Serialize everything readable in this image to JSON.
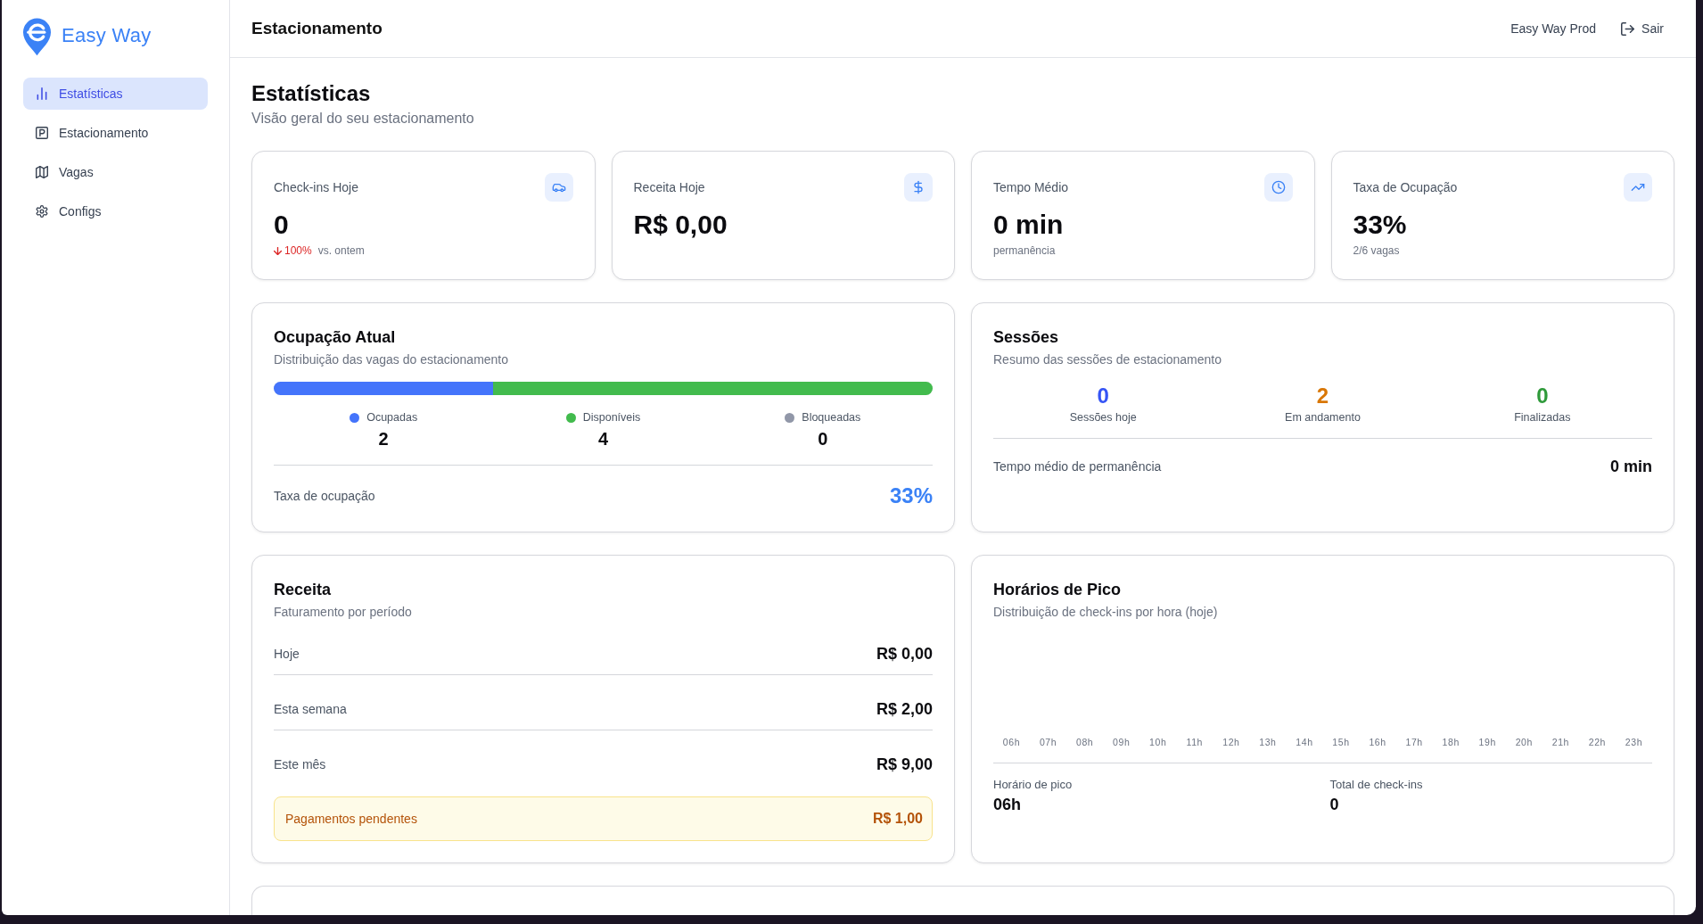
{
  "sidebar": {
    "brand": "Easy Way",
    "items": [
      {
        "label": "Estatísticas",
        "selected": true
      },
      {
        "label": "Estacionamento",
        "selected": false
      },
      {
        "label": "Vagas",
        "selected": false
      },
      {
        "label": "Configs",
        "selected": false
      }
    ]
  },
  "header": {
    "title": "Estacionamento",
    "account": "Easy Way Prod",
    "logout": "Sair"
  },
  "page": {
    "title": "Estatísticas",
    "subtitle": "Visão geral do seu estacionamento"
  },
  "stat_cards": [
    {
      "label": "Check-ins Hoje",
      "value": "0",
      "trend": {
        "decrease": true,
        "value": "100%",
        "note": "vs. ontem"
      }
    },
    {
      "label": "Receita Hoje",
      "value": "R$ 0,00"
    },
    {
      "label": "Tempo Médio",
      "value": "0 min",
      "note": "permanência"
    },
    {
      "label": "Taxa de Ocupação",
      "value": "33%",
      "note": "2/6 vagas"
    }
  ],
  "occupancy": {
    "title": "Ocupação Atual",
    "subtitle": "Distribuição das vagas do estacionamento",
    "legend": [
      {
        "label": "Ocupadas",
        "value": "2",
        "color": "#4474fb",
        "level": 0.333
      },
      {
        "label": "Disponíveis",
        "value": "4",
        "color": "#42bb4d",
        "level": 0.667
      },
      {
        "label": "Bloqueadas",
        "value": "0",
        "color": "#9197a8"
      }
    ],
    "rate_label": "Taxa de ocupação",
    "rate_value": "33%"
  },
  "sessions": {
    "title": "Sessões",
    "subtitle": "Resumo das sessões de estacionamento",
    "stats": [
      {
        "value": "0",
        "label": "Sessões hoje",
        "color": "#3554f5"
      },
      {
        "value": "2",
        "label": "Em andamento",
        "color": "#d97706"
      },
      {
        "value": "0",
        "label": "Finalizadas",
        "color": "#2f9a3a"
      }
    ],
    "average_label": "Tempo médio de permanência",
    "average_value": "0 min"
  },
  "revenue": {
    "title": "Receita",
    "subtitle": "Faturamento por período",
    "rows": [
      {
        "label": "Hoje",
        "value": "R$ 0,00"
      },
      {
        "label": "Esta semana",
        "value": "R$ 2,00"
      },
      {
        "label": "Este mês",
        "value": "R$ 9,00"
      }
    ],
    "pending": {
      "label": "Pagamentos pendentes",
      "value": "R$ 1,00"
    }
  },
  "peak_hours": {
    "title": "Horários de Pico",
    "subtitle": "Distribuição de check-ins por hora (hoje)",
    "hours": [
      "06h",
      "07h",
      "08h",
      "09h",
      "10h",
      "11h",
      "12h",
      "13h",
      "14h",
      "15h",
      "16h",
      "17h",
      "18h",
      "19h",
      "20h",
      "21h",
      "22h",
      "23h"
    ],
    "summary": [
      {
        "label": "Horário de pico",
        "value": "06h"
      },
      {
        "label": "Total de check-ins",
        "value": "0"
      }
    ]
  }
}
